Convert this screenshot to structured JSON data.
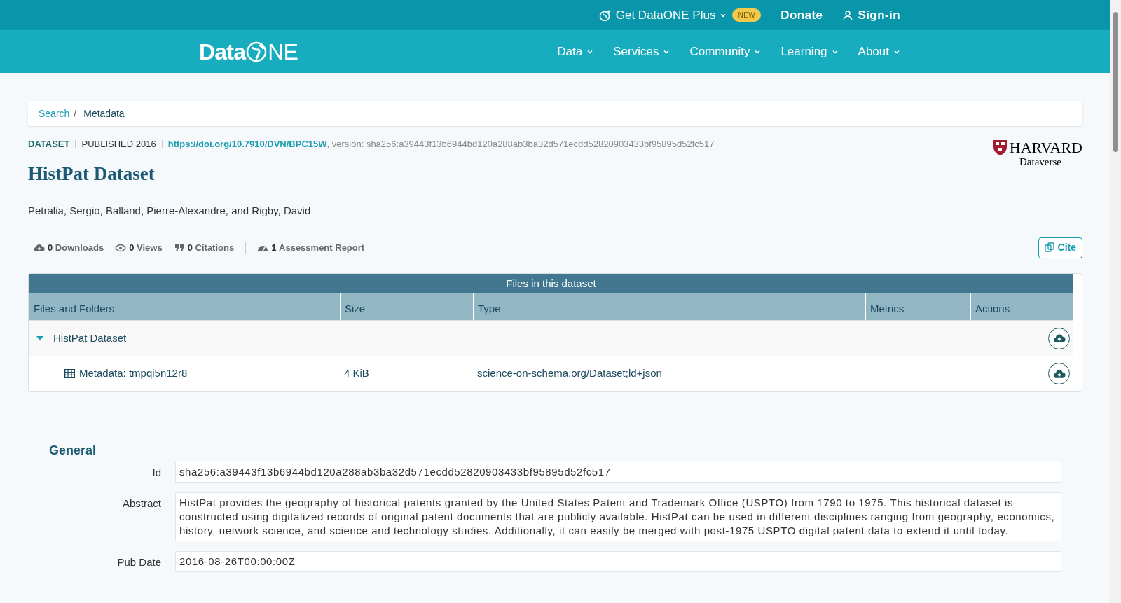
{
  "top_bar": {
    "plus": {
      "label": "Get DataONE Plus",
      "badge": "NEW"
    },
    "donate": "Donate",
    "sign_in": "Sign-in"
  },
  "logo": {
    "prefix": "Data",
    "suffix": "NE"
  },
  "nav": [
    "Data",
    "Services",
    "Community",
    "Learning",
    "About"
  ],
  "breadcrumb_separator": "/",
  "breadcrumb": [
    {
      "label": "Search",
      "link": true
    },
    {
      "label": "Metadata",
      "link": false
    }
  ],
  "meta": {
    "type": "DATASET",
    "published": "PUBLISHED 2016",
    "doi": "https://doi.org/10.7910/DVN/BPC15W",
    "version": ", version: sha256:a39443f13b6944bd120a288ab3ba32d571ecdd52820903433bf95895d52fc517"
  },
  "repository_logo": {
    "line1": "HARVARD",
    "line2": "Dataverse"
  },
  "title": "HistPat Dataset",
  "authors": "Petralia, Sergio, Balland, Pierre-Alexandre, and Rigby, David",
  "stats": [
    {
      "kind": "downloads",
      "count": "0",
      "label": "Downloads"
    },
    {
      "kind": "views",
      "count": "0",
      "label": "Views"
    },
    {
      "kind": "citations",
      "count": "0",
      "label": "Citations"
    },
    {
      "kind": "assessment",
      "count": "1",
      "label": "Assessment Report"
    }
  ],
  "cite_button": "Cite",
  "files_table": {
    "title": "Files in this dataset",
    "columns": [
      "Files and Folders",
      "Size",
      "Type",
      "Metrics",
      "Actions"
    ],
    "rows": [
      {
        "kind": "folder",
        "name": "HistPat Dataset",
        "expanded": true
      },
      {
        "kind": "file",
        "name": "Metadata: tmpqi5n12r8",
        "size": "4 KiB",
        "type": "science-on-schema.org/Dataset;ld+json"
      }
    ]
  },
  "general": {
    "heading": "General",
    "fields": [
      {
        "label": "Id",
        "value": "sha256:a39443f13b6944bd120a288ab3ba32d571ecdd52820903433bf95895d52fc517"
      },
      {
        "label": "Abstract",
        "value": "HistPat provides the geography of historical patents granted by the United States Patent and Trademark Office (USPTO) from 1790 to 1975. This historical dataset is constructed using digitalized records of original patent documents that are publicly available. HistPat can be used in different disciplines ranging from geography, economics, history, network science, and science and technology studies. Additionally, it can easily be merged with post-1975 USPTO digital patent data to extend it until today."
      },
      {
        "label": "Pub Date",
        "value": "2016-08-26T00:00:00Z"
      }
    ]
  }
}
